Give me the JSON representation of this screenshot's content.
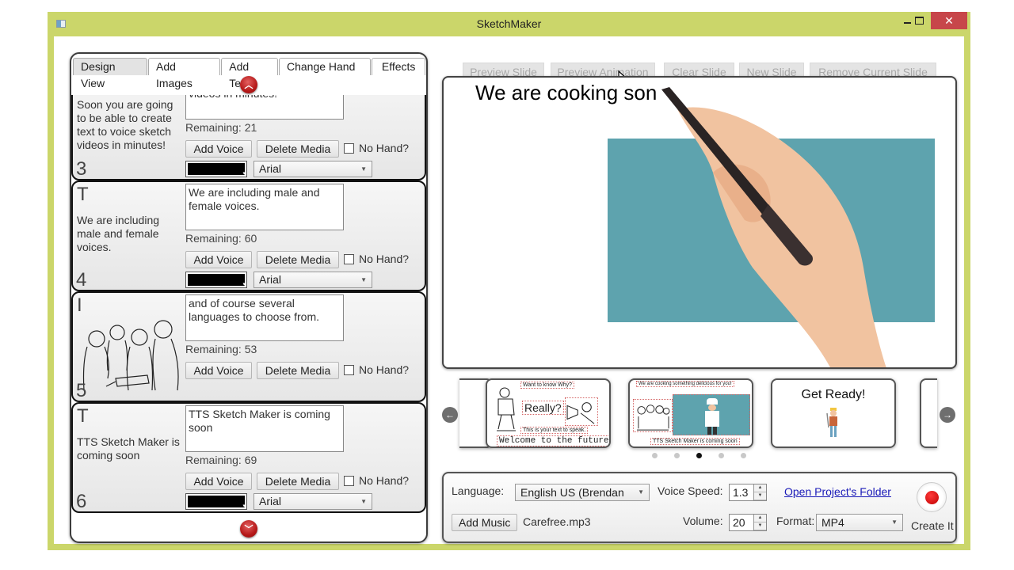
{
  "window": {
    "title": "SketchMaker"
  },
  "tabs": [
    {
      "label": "Design View",
      "active": true
    },
    {
      "label": "Add Images",
      "active": false
    },
    {
      "label": "Add Text",
      "active": false
    },
    {
      "label": "Change Hand",
      "active": false
    },
    {
      "label": "Effects",
      "active": false
    }
  ],
  "slide_cards": [
    {
      "type_letter": "",
      "summary": "Soon you are going to be able to create text to voice sketch videos in minutes!",
      "number": "3",
      "text_value": "to create text to voice sketch videos in minutes!",
      "remaining": "Remaining: 21",
      "add_voice": "Add Voice",
      "delete_media": "Delete Media",
      "no_hand": "No Hand?",
      "color": "#000000",
      "font": "Arial"
    },
    {
      "type_letter": "T",
      "summary": "We are including male and female voices.",
      "number": "4",
      "text_value": "We are including male and female voices.",
      "remaining": "Remaining: 60",
      "add_voice": "Add Voice",
      "delete_media": "Delete Media",
      "no_hand": "No Hand?",
      "color": "#000000",
      "font": "Arial"
    },
    {
      "type_letter": "I",
      "summary": "",
      "number": "5",
      "text_value": "and of course several languages to choose from.",
      "remaining": "Remaining: 53",
      "add_voice": "Add Voice",
      "delete_media": "Delete Media",
      "no_hand": "No Hand?",
      "image": "people-sketch"
    },
    {
      "type_letter": "T",
      "summary": "TTS Sketch Maker is coming soon",
      "number": "6",
      "text_value": "TTS Sketch Maker is coming soon",
      "remaining": "Remaining: 69",
      "add_voice": "Add Voice",
      "delete_media": "Delete Media",
      "no_hand": "No Hand?",
      "color": "#000000",
      "font": "Arial"
    }
  ],
  "toolbar": {
    "preview_slide": "Preview Slide",
    "preview_animation": "Preview Animation",
    "clear_slide": "Clear Slide",
    "new_slide": "New Slide",
    "remove_current_slide": "Remove Current Slide"
  },
  "canvas": {
    "text": "We are cooking son",
    "image_color": "#5ea3ae"
  },
  "carousel": {
    "thumbnails": [
      {
        "labels": [
          "Want to know Why?",
          "Really?",
          "This is your text to speak.",
          "Welcome to the future!"
        ]
      },
      {
        "labels": [
          "We are cooking something delicious for you!",
          "TTS Sketch Maker is coming soon"
        ]
      },
      {
        "labels": [
          "Get Ready!"
        ]
      }
    ],
    "dots": 5,
    "active_dot": 3
  },
  "settings": {
    "language_label": "Language:",
    "language_value": "English US (Brendan",
    "voice_speed_label": "Voice Speed:",
    "voice_speed_value": "1.3",
    "open_folder": "Open Project's Folder",
    "add_music": "Add Music",
    "music_file": "Carefree.mp3",
    "volume_label": "Volume:",
    "volume_value": "20",
    "format_label": "Format:",
    "format_value": "MP4",
    "create_it": "Create It"
  }
}
